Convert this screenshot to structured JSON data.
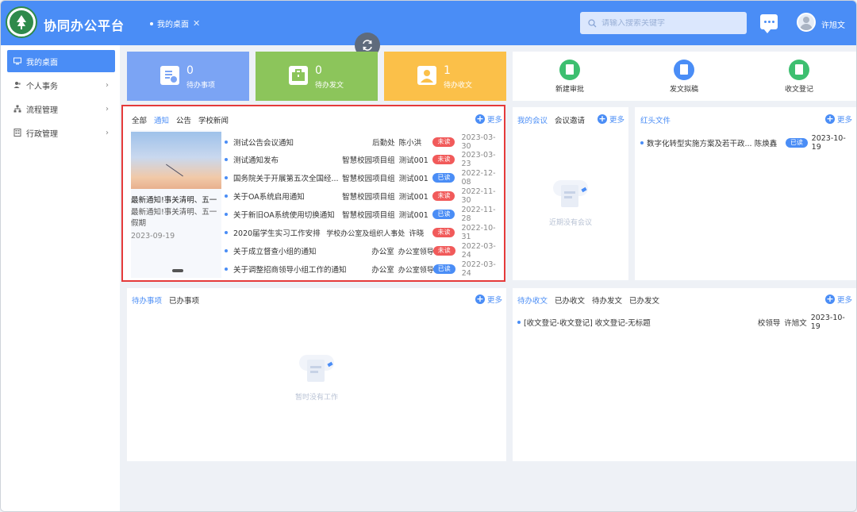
{
  "header": {
    "brand": "协同办公平台",
    "tab": "我的桌面",
    "tab_close": "✕",
    "search_placeholder": "请输入搜索关键字",
    "user": "许旭文"
  },
  "sidebar": {
    "items": [
      {
        "label": "我的桌面",
        "active": true
      },
      {
        "label": "个人事务"
      },
      {
        "label": "流程管理"
      },
      {
        "label": "行政管理"
      }
    ]
  },
  "stats": [
    {
      "value": "0",
      "label": "待办事项",
      "color": "#7ba4f4"
    },
    {
      "value": "0",
      "label": "待办发文",
      "color": "#8cc55b"
    },
    {
      "value": "1",
      "label": "待办收文",
      "color": "#fbc049"
    }
  ],
  "quick_actions": [
    {
      "label": "新建审批",
      "color": "#3dbf70"
    },
    {
      "label": "发文拟稿",
      "color": "#4a8df6"
    },
    {
      "label": "收文登记",
      "color": "#3dbf70"
    }
  ],
  "notice": {
    "tabs": [
      "全部",
      "通知",
      "公告",
      "学校新闻"
    ],
    "active_tab_index": 1,
    "more": "更多",
    "feature": {
      "title": "最新通知!事关清明、五一",
      "summary": "最新通知!事关清明、五一假期",
      "date": "2023-09-19"
    },
    "rows": [
      {
        "title": "测试公告会议通知",
        "dept": "后勤处",
        "author": "陈小洪",
        "status": "未读",
        "read": false,
        "date": "2023-03-30"
      },
      {
        "title": "测试通知发布",
        "dept": "智慧校园项目组",
        "author": "测试001",
        "status": "未读",
        "read": false,
        "date": "2023-03-23"
      },
      {
        "title": "国务院关于开展第五次全国经...",
        "dept": "智慧校园项目组",
        "author": "测试001",
        "status": "已读",
        "read": true,
        "date": "2022-12-08"
      },
      {
        "title": "关于OA系统启用通知",
        "dept": "智慧校园项目组",
        "author": "测试001",
        "status": "未读",
        "read": false,
        "date": "2022-11-30"
      },
      {
        "title": "关于新旧OA系统使用切换通知",
        "dept": "智慧校园项目组",
        "author": "测试001",
        "status": "已读",
        "read": true,
        "date": "2022-11-28"
      },
      {
        "title": "2020届学生实习工作安排",
        "dept": "学校办公室及组织人事处",
        "author": "许晓",
        "status": "未读",
        "read": false,
        "date": "2022-10-31"
      },
      {
        "title": "关于成立督查小组的通知",
        "dept": "办公室",
        "author": "办公室领导1",
        "status": "未读",
        "read": false,
        "date": "2022-03-24"
      },
      {
        "title": "关于调整招商领导小组工作的通知",
        "dept": "办公室",
        "author": "办公室领导1",
        "status": "已读",
        "read": true,
        "date": "2022-03-24"
      }
    ]
  },
  "meetings": {
    "tabs": [
      "我的会议",
      "会议邀请"
    ],
    "more": "更多",
    "empty": "近期没有会议"
  },
  "redhead": {
    "title": "红头文件",
    "more": "更多",
    "rows": [
      {
        "title": "数字化转型实施方案及若干政...",
        "author": "陈焕鑫",
        "status": "已读",
        "date": "2023-10-19"
      }
    ]
  },
  "tasks": {
    "tabs": [
      "待办事项",
      "已办事项"
    ],
    "more": "更多",
    "empty": "暂时没有工作"
  },
  "docs": {
    "tabs": [
      "待办收文",
      "已办收文",
      "待办发文",
      "已办发文"
    ],
    "more": "更多",
    "rows": [
      {
        "title": "[收文登记-收文登记] 收文登记-无标题",
        "dept": "校领导",
        "author": "许旭文",
        "date": "2023-10-19"
      }
    ]
  }
}
